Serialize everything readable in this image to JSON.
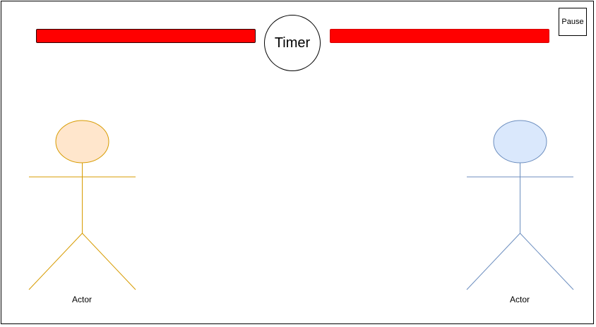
{
  "timer": {
    "label": "Timer"
  },
  "pause": {
    "label": "Pause"
  },
  "players": [
    {
      "label": "Actor",
      "head_fill": "#ffe6cc",
      "stroke": "#d79b00",
      "health": 1.0,
      "health_color": "#ff0000"
    },
    {
      "label": "Actor",
      "head_fill": "#dae8fc",
      "stroke": "#6c8ebf",
      "health": 1.0,
      "health_color": "#ff0000"
    }
  ]
}
